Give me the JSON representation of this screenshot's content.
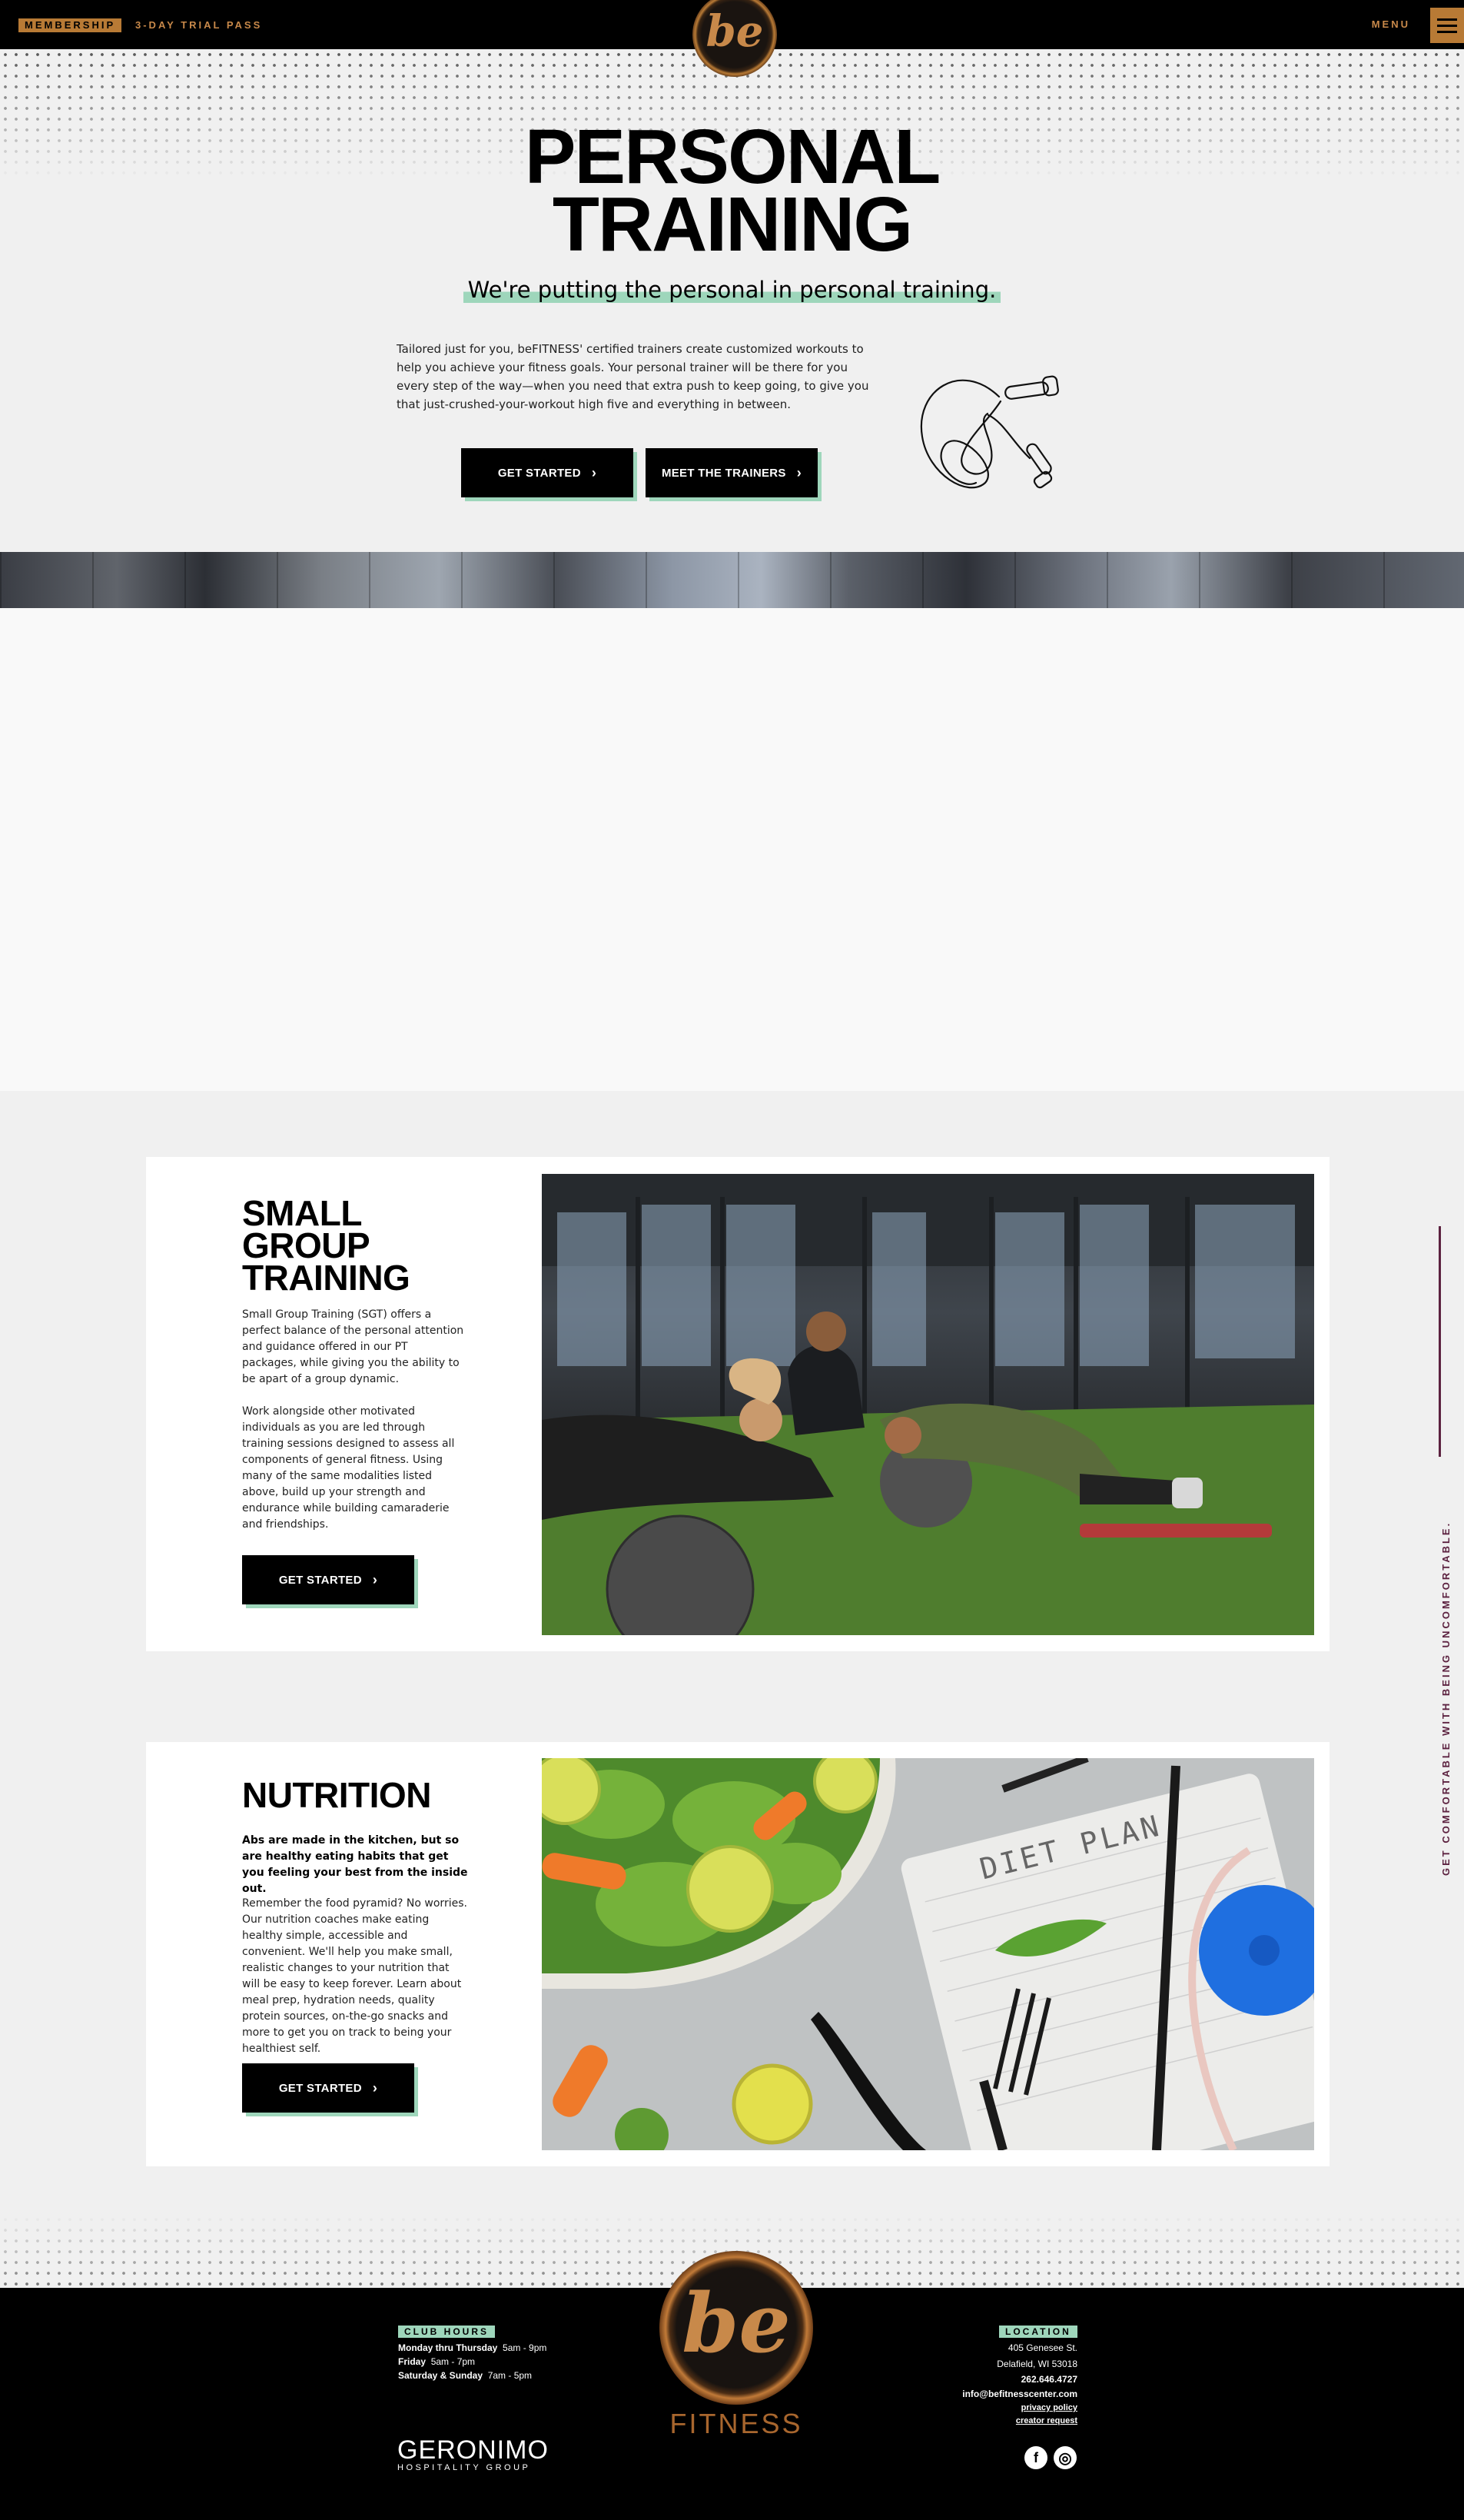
{
  "topbar": {
    "membership": "MEMBERSHIP",
    "trial": "3-DAY TRIAL PASS",
    "menu": "MENU",
    "logo_text": "be"
  },
  "hero": {
    "title_line1": "PERSONAL",
    "title_line2": "TRAINING",
    "subtitle": "We're putting the personal in personal training.",
    "body": "Tailored just for you, beFITNESS' certified trainers create customized workouts to help you achieve your fitness goals. Your personal trainer will be there for you every step of the way—when you need that extra push to keep going, to give you that just-crushed-your-workout high five and everything in between.",
    "btn_started": "GET STARTED",
    "btn_trainers": "MEET THE TRAINERS"
  },
  "sgt": {
    "title_l1": "SMALL",
    "title_l2": "GROUP",
    "title_l3": "TRAINING",
    "para1": "Small Group Training (SGT) offers a perfect balance of the personal attention and guidance offered in our PT packages, while giving you the ability to be apart of  a group dynamic.",
    "para2": "Work alongside other motivated individuals as you are led through training sessions designed to assess all components of general fitness. Using many of the same modalities listed above, build up your strength and endurance while building camaraderie and friendships.",
    "btn": "GET STARTED"
  },
  "nutrition": {
    "title": "NUTRITION",
    "lead": "Abs are made in the kitchen, but so are healthy eating habits that get you feeling your best from the inside out.",
    "para": "Remember the food pyramid? No worries. Our nutrition coaches make eating healthy simple, accessible and convenient. We'll help you make small, realistic changes to your nutrition that will be easy to keep forever. Learn about meal prep, hydration needs, quality protein sources, on-the-go snacks and more to get you on track to being your healthiest self.",
    "btn": "GET STARTED",
    "notebook_text": "DIET PLAN"
  },
  "side": {
    "text": "GET COMFORTABLE WITH BEING UNCOMFORTABLE."
  },
  "footer": {
    "hours_label": "CLUB HOURS",
    "hours": [
      {
        "days": "Monday thru Thursday",
        "time": "5am - 9pm"
      },
      {
        "days": "Friday",
        "time": "5am - 7pm"
      },
      {
        "days": "Saturday & Sunday",
        "time": "7am - 5pm"
      }
    ],
    "logo_text": "be",
    "logo_word": "FITNESS",
    "location_label": "LOCATION",
    "street": "405 Genesee St.",
    "city": "Delafield, WI 53018",
    "phone": "262.646.4727",
    "email": "info@befitnesscenter.com",
    "privacy": "privacy policy",
    "creator": "creator request",
    "geronimo_l1": "GERONIMO",
    "geronimo_l2": "HOSPITALITY GROUP",
    "facebook_glyph": "f",
    "instagram_glyph": "◎"
  },
  "colors": {
    "accent_mint": "#9ed6bb",
    "brand_copper": "#b87a35",
    "side_text": "#5c2240"
  }
}
